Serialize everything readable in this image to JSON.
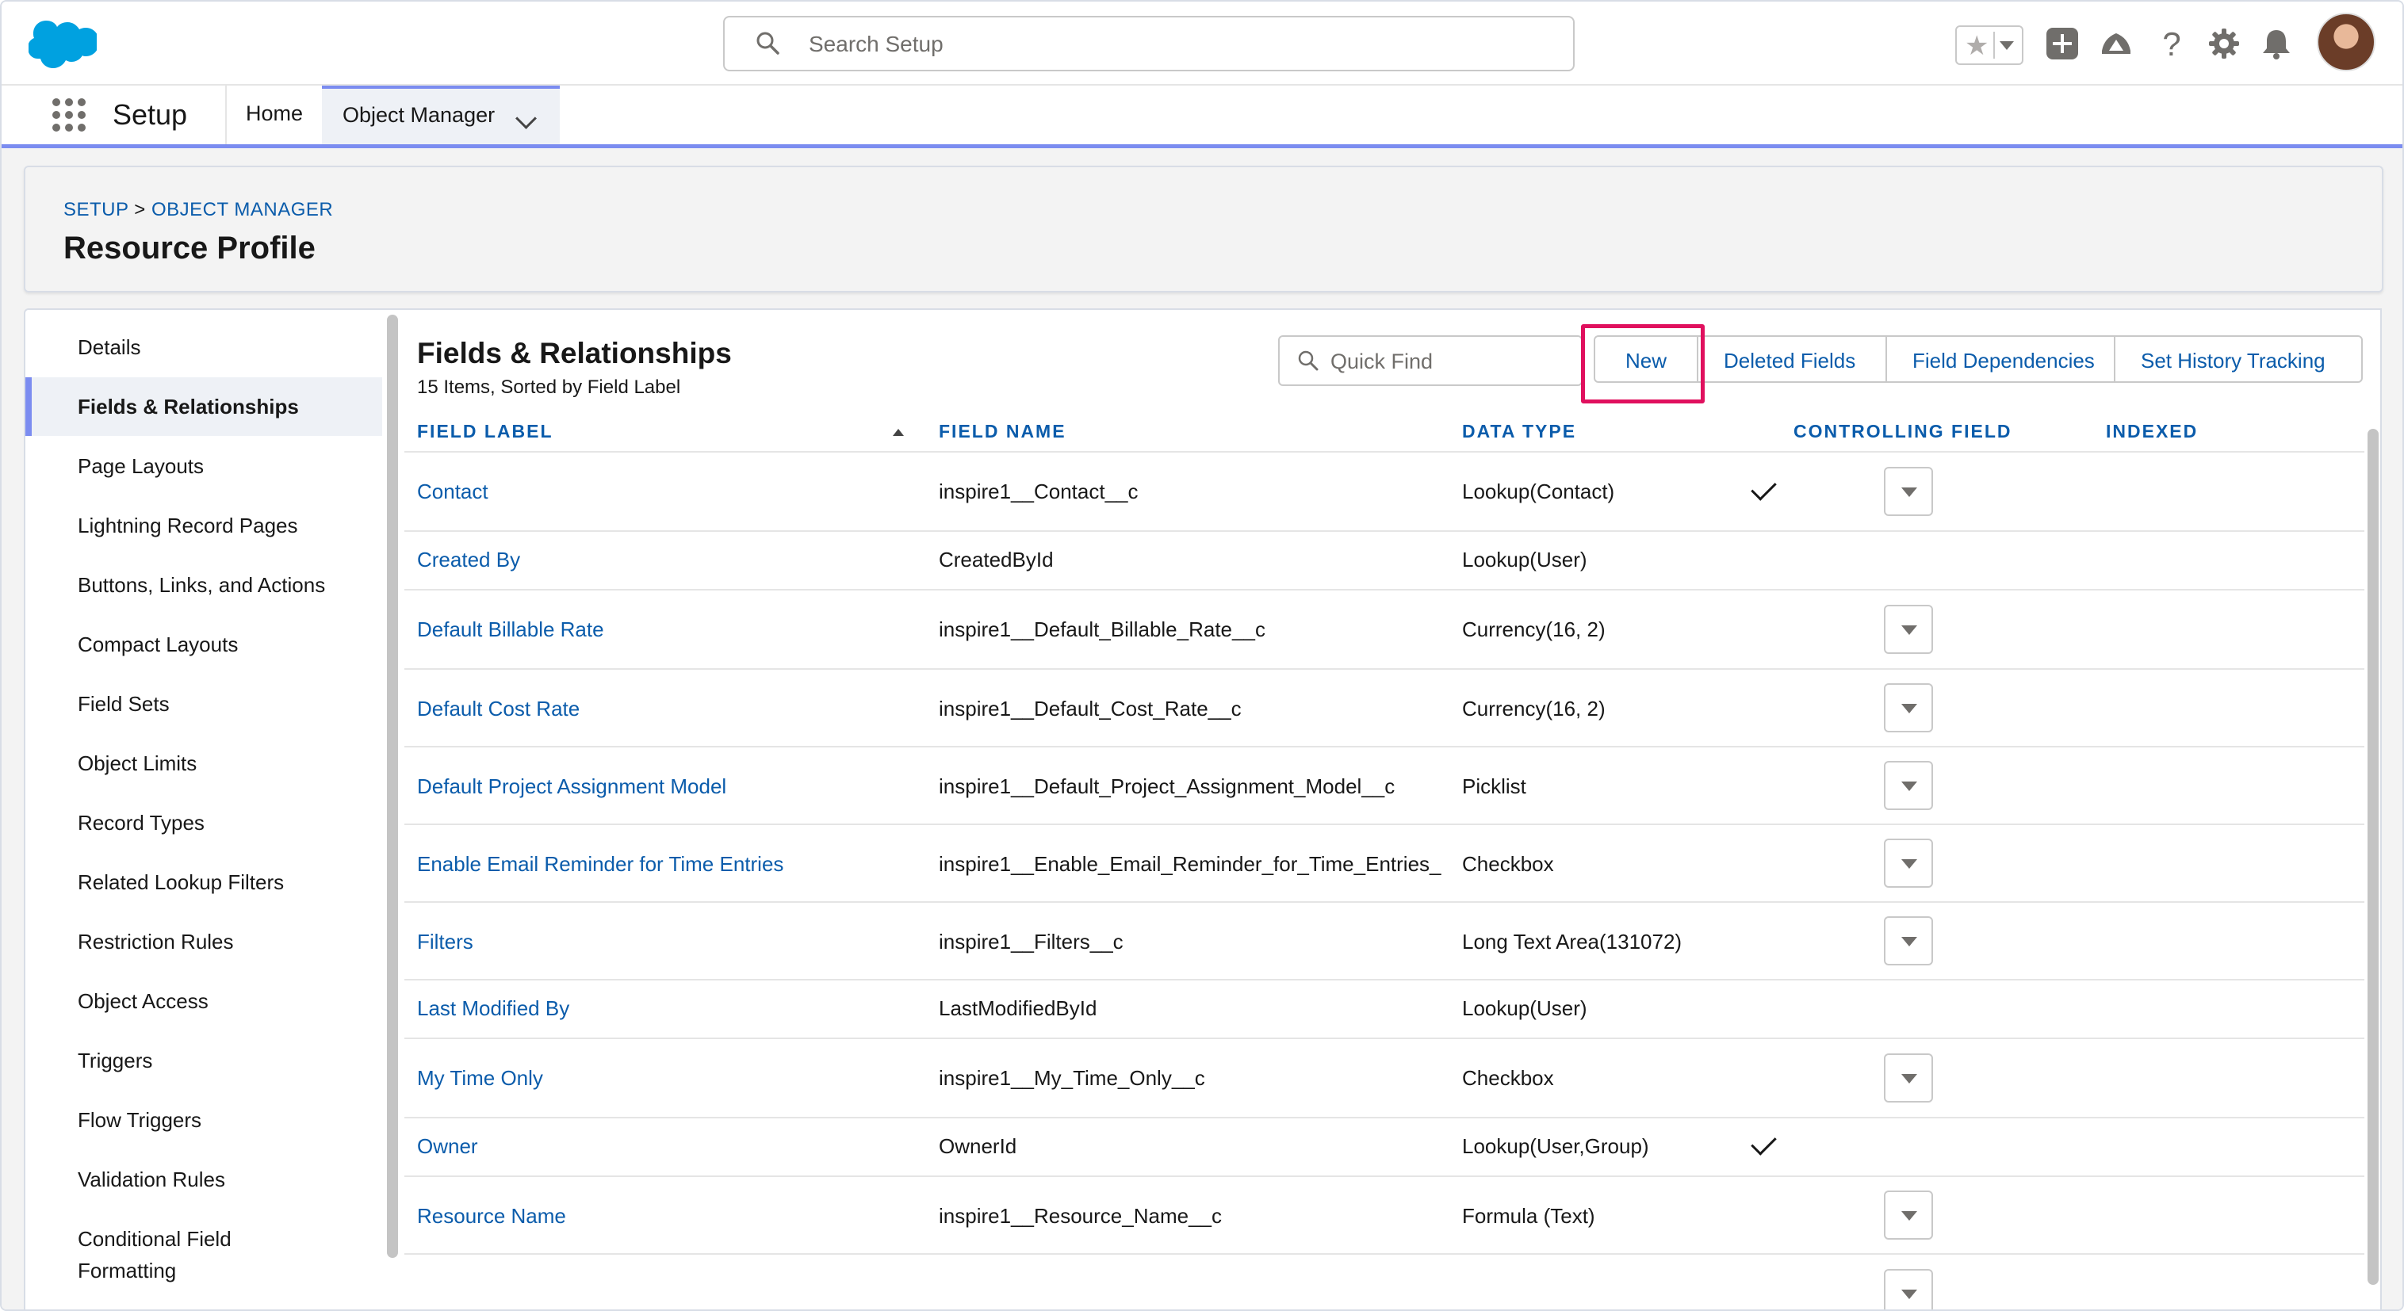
{
  "topbar": {
    "search_placeholder": "Search Setup",
    "icons": [
      "favorites-star-icon",
      "add-icon",
      "trailhead-icon",
      "help-icon",
      "gear-icon",
      "bell-icon",
      "avatar"
    ]
  },
  "nav": {
    "app_title": "Setup",
    "home": "Home",
    "object_manager": "Object Manager"
  },
  "header": {
    "crumb_setup": "SETUP",
    "crumb_sep": ">",
    "crumb_om": "OBJECT MANAGER",
    "title": "Resource Profile"
  },
  "sidebar": {
    "items": [
      {
        "label": "Details"
      },
      {
        "label": "Fields & Relationships",
        "active": true
      },
      {
        "label": "Page Layouts"
      },
      {
        "label": "Lightning Record Pages"
      },
      {
        "label": "Buttons, Links, and Actions"
      },
      {
        "label": "Compact Layouts"
      },
      {
        "label": "Field Sets"
      },
      {
        "label": "Object Limits"
      },
      {
        "label": "Record Types"
      },
      {
        "label": "Related Lookup Filters"
      },
      {
        "label": "Restriction Rules"
      },
      {
        "label": "Object Access"
      },
      {
        "label": "Triggers"
      },
      {
        "label": "Flow Triggers"
      },
      {
        "label": "Validation Rules"
      },
      {
        "label": "Conditional Field"
      },
      {
        "label": "Formatting"
      }
    ]
  },
  "main": {
    "title": "Fields & Relationships",
    "subtitle": "15 Items, Sorted by Field Label",
    "quick_find_placeholder": "Quick Find",
    "buttons": {
      "new": "New",
      "deleted_fields": "Deleted Fields",
      "field_dependencies": "Field Dependencies",
      "set_history_tracking": "Set History Tracking"
    },
    "columns": [
      "FIELD LABEL",
      "FIELD NAME",
      "DATA TYPE",
      "CONTROLLING FIELD",
      "INDEXED"
    ],
    "rows": [
      {
        "label": "Contact",
        "name": "inspire1__Contact__c",
        "type": "Lookup(Contact)",
        "controlling": "",
        "indexed": true,
        "menu": true
      },
      {
        "label": "Created By",
        "name": "CreatedById",
        "type": "Lookup(User)",
        "controlling": "",
        "indexed": false,
        "menu": false
      },
      {
        "label": "Default Billable Rate",
        "name": "inspire1__Default_Billable_Rate__c",
        "type": "Currency(16, 2)",
        "controlling": "",
        "indexed": false,
        "menu": true
      },
      {
        "label": "Default Cost Rate",
        "name": "inspire1__Default_Cost_Rate__c",
        "type": "Currency(16, 2)",
        "controlling": "",
        "indexed": false,
        "menu": true
      },
      {
        "label": "Default Project Assignment Model",
        "name": "inspire1__Default_Project_Assignment_Model__c",
        "type": "Picklist",
        "controlling": "",
        "indexed": false,
        "menu": true
      },
      {
        "label": "Enable Email Reminder for Time Entries",
        "name": "inspire1__Enable_Email_Reminder_for_Time_Entries_",
        "type": "Checkbox",
        "controlling": "",
        "indexed": false,
        "menu": true
      },
      {
        "label": "Filters",
        "name": "inspire1__Filters__c",
        "type": "Long Text Area(131072)",
        "controlling": "",
        "indexed": false,
        "menu": true
      },
      {
        "label": "Last Modified By",
        "name": "LastModifiedById",
        "type": "Lookup(User)",
        "controlling": "",
        "indexed": false,
        "menu": false
      },
      {
        "label": "My Time Only",
        "name": "inspire1__My_Time_Only__c",
        "type": "Checkbox",
        "controlling": "",
        "indexed": false,
        "menu": true
      },
      {
        "label": "Owner",
        "name": "OwnerId",
        "type": "Lookup(User,Group)",
        "controlling": "",
        "indexed": true,
        "menu": false
      },
      {
        "label": "Resource Name",
        "name": "inspire1__Resource_Name__c",
        "type": "Formula (Text)",
        "controlling": "",
        "indexed": false,
        "menu": true
      }
    ]
  },
  "colors": {
    "brand_blue": "#0b5cab",
    "nav_accent": "#7b8cf0",
    "highlight": "#e0105e",
    "salesforce_cloud": "#00a1e0"
  }
}
